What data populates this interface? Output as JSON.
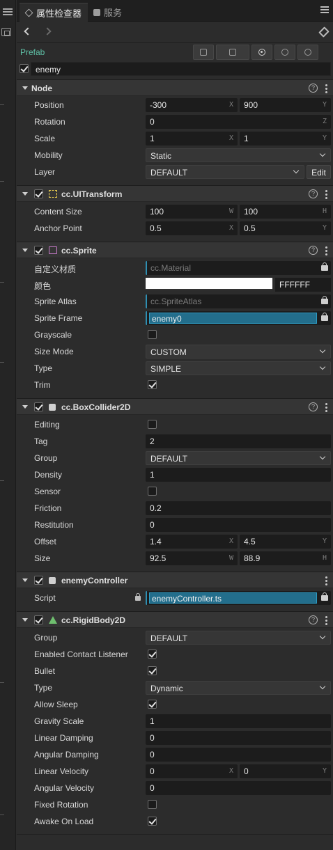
{
  "tabs": [
    {
      "label": "属性检查器"
    },
    {
      "label": "服务"
    }
  ],
  "prefab": {
    "label": "Prefab"
  },
  "node_name": "enemy",
  "node": {
    "title": "Node",
    "position_label": "Position",
    "position_x": "-300",
    "position_y": "900",
    "rotation_label": "Rotation",
    "rotation_z": "0",
    "scale_label": "Scale",
    "scale_x": "1",
    "scale_y": "1",
    "mobility_label": "Mobility",
    "mobility_value": "Static",
    "layer_label": "Layer",
    "layer_value": "DEFAULT",
    "edit_label": "Edit"
  },
  "ui_transform": {
    "title": "cc.UITransform",
    "content_size_label": "Content Size",
    "w": "100",
    "h": "100",
    "anchor_label": "Anchor Point",
    "ax": "0.5",
    "ay": "0.5"
  },
  "sprite": {
    "title": "cc.Sprite",
    "material_label": "自定义材质",
    "material_value": "cc.Material",
    "color_label": "颜色",
    "color_hex": "FFFFFF",
    "atlas_label": "Sprite Atlas",
    "atlas_value": "cc.SpriteAtlas",
    "frame_label": "Sprite Frame",
    "frame_value": "enemy0",
    "grayscale_label": "Grayscale",
    "grayscale": false,
    "size_mode_label": "Size Mode",
    "size_mode_value": "CUSTOM",
    "type_label": "Type",
    "type_value": "SIMPLE",
    "trim_label": "Trim",
    "trim": true
  },
  "box_collider": {
    "title": "cc.BoxCollider2D",
    "editing_label": "Editing",
    "editing": false,
    "tag_label": "Tag",
    "tag_value": "2",
    "group_label": "Group",
    "group_value": "DEFAULT",
    "density_label": "Density",
    "density_value": "1",
    "sensor_label": "Sensor",
    "sensor": false,
    "friction_label": "Friction",
    "friction_value": "0.2",
    "restitution_label": "Restitution",
    "restitution_value": "0",
    "offset_label": "Offset",
    "offset_x": "1.4",
    "offset_y": "4.5",
    "size_label": "Size",
    "size_w": "92.5",
    "size_h": "88.9"
  },
  "enemy_controller": {
    "title": "enemyController",
    "script_label": "Script",
    "script_value": "enemyController.ts"
  },
  "rigid_body": {
    "title": "cc.RigidBody2D",
    "group_label": "Group",
    "group_value": "DEFAULT",
    "contact_label": "Enabled Contact Listener",
    "contact": true,
    "bullet_label": "Bullet",
    "bullet": true,
    "type_label": "Type",
    "type_value": "Dynamic",
    "allow_sleep_label": "Allow Sleep",
    "allow_sleep": true,
    "gravity_label": "Gravity Scale",
    "gravity_value": "1",
    "linear_damping_label": "Linear Damping",
    "linear_damping_value": "0",
    "angular_damping_label": "Angular Damping",
    "angular_damping_value": "0",
    "linear_velocity_label": "Linear Velocity",
    "lv_x": "0",
    "lv_y": "0",
    "angular_velocity_label": "Angular Velocity",
    "angular_velocity_value": "0",
    "fixed_rotation_label": "Fixed Rotation",
    "fixed_rotation": false,
    "awake_label": "Awake On Load",
    "awake": true
  },
  "axis": {
    "x": "X",
    "y": "Y",
    "z": "Z",
    "w": "W",
    "h": "H"
  },
  "help_glyph": "?"
}
